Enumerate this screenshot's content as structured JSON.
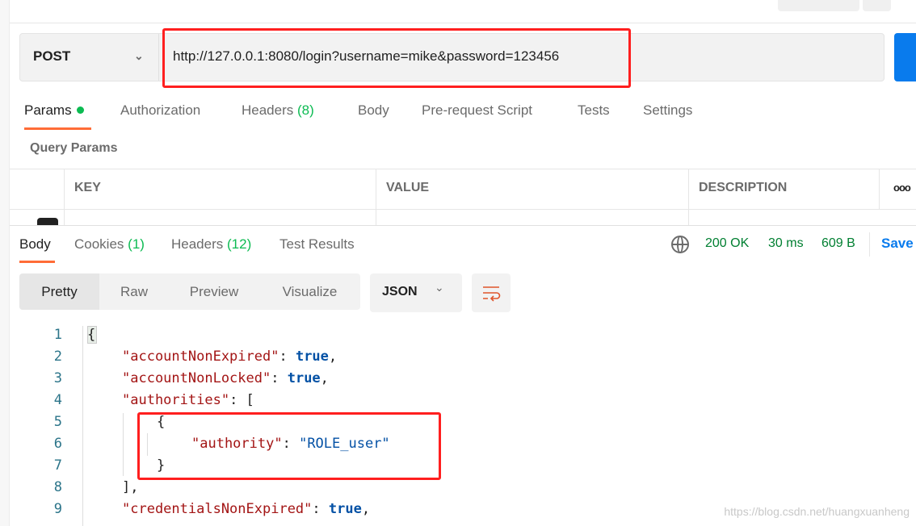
{
  "request": {
    "method": "POST",
    "url": "http://127.0.0.1:8080/login?username=mike&password=123456"
  },
  "request_tabs": [
    {
      "label": "Params",
      "active": true,
      "dot": true
    },
    {
      "label": "Authorization"
    },
    {
      "label": "Headers",
      "count": "(8)"
    },
    {
      "label": "Body"
    },
    {
      "label": "Pre-request Script"
    },
    {
      "label": "Tests"
    },
    {
      "label": "Settings"
    }
  ],
  "query_params": {
    "title": "Query Params",
    "columns": [
      "KEY",
      "VALUE",
      "DESCRIPTION"
    ],
    "more": "ooo"
  },
  "response_tabs": [
    {
      "label": "Body",
      "active": true
    },
    {
      "label": "Cookies",
      "count": "(1)"
    },
    {
      "label": "Headers",
      "count": "(12)"
    },
    {
      "label": "Test Results"
    }
  ],
  "status": {
    "code": "200 OK",
    "time": "30 ms",
    "size": "609 B",
    "save": "Save"
  },
  "view_modes": [
    "Pretty",
    "Raw",
    "Preview",
    "Visualize"
  ],
  "format": "JSON",
  "code_lines": [
    {
      "n": "1",
      "indent": 0,
      "tokens": [
        {
          "t": "{",
          "c": "p"
        }
      ]
    },
    {
      "n": "2",
      "indent": 1,
      "tokens": [
        {
          "t": "\"accountNonExpired\"",
          "c": "k"
        },
        {
          "t": ": ",
          "c": "p"
        },
        {
          "t": "true",
          "c": "b"
        },
        {
          "t": ",",
          "c": "p"
        }
      ]
    },
    {
      "n": "3",
      "indent": 1,
      "tokens": [
        {
          "t": "\"accountNonLocked\"",
          "c": "k"
        },
        {
          "t": ": ",
          "c": "p"
        },
        {
          "t": "true",
          "c": "b"
        },
        {
          "t": ",",
          "c": "p"
        }
      ]
    },
    {
      "n": "4",
      "indent": 1,
      "tokens": [
        {
          "t": "\"authorities\"",
          "c": "k"
        },
        {
          "t": ": [",
          "c": "p"
        }
      ]
    },
    {
      "n": "5",
      "indent": 2,
      "tokens": [
        {
          "t": "{",
          "c": "p"
        }
      ]
    },
    {
      "n": "6",
      "indent": 3,
      "tokens": [
        {
          "t": "\"authority\"",
          "c": "k"
        },
        {
          "t": ": ",
          "c": "p"
        },
        {
          "t": "\"ROLE_user\"",
          "c": "s"
        }
      ]
    },
    {
      "n": "7",
      "indent": 2,
      "tokens": [
        {
          "t": "}",
          "c": "p"
        }
      ]
    },
    {
      "n": "8",
      "indent": 1,
      "tokens": [
        {
          "t": "],",
          "c": "p"
        }
      ]
    },
    {
      "n": "9",
      "indent": 1,
      "tokens": [
        {
          "t": "\"credentialsNonExpired\"",
          "c": "k"
        },
        {
          "t": ": ",
          "c": "p"
        },
        {
          "t": "true",
          "c": "b"
        },
        {
          "t": ",",
          "c": "p"
        }
      ]
    }
  ],
  "watermark": "https://blog.csdn.net/huangxuanheng",
  "colors": {
    "accent": "#ff6c37",
    "send": "#097bed",
    "status": "#007f31",
    "annotation": "#ff1f1f"
  }
}
